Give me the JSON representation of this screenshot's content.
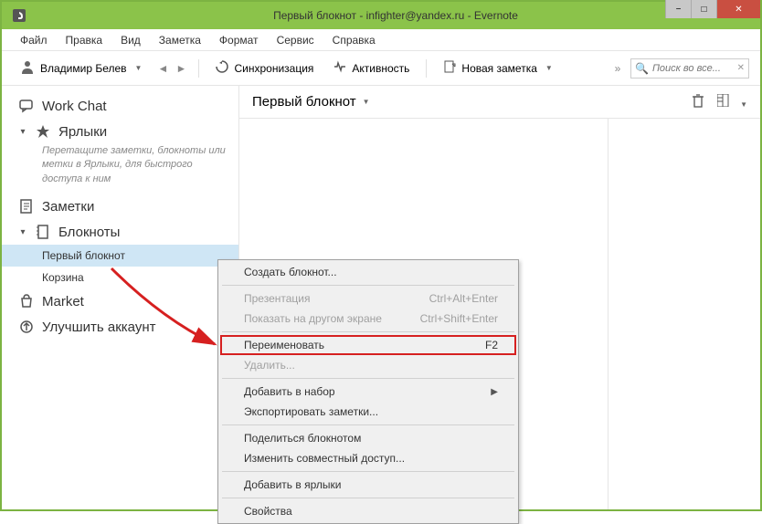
{
  "window": {
    "title": "Первый блокнот - infighter@yandex.ru - Evernote"
  },
  "menu": [
    "Файл",
    "Правка",
    "Вид",
    "Заметка",
    "Формат",
    "Сервис",
    "Справка"
  ],
  "toolbar": {
    "user": "Владимир Белев",
    "sync": "Синхронизация",
    "activity": "Активность",
    "newnote": "Новая заметка",
    "search_placeholder": "Поиск во все..."
  },
  "sidebar": {
    "workchat": "Work Chat",
    "shortcuts": "Ярлыки",
    "shortcuts_hint": "Перетащите заметки, блокноты или метки в Ярлыки, для быстрого доступа к ним",
    "notes": "Заметки",
    "notebooks": "Блокноты",
    "notebook_items": [
      "Первый блокнот",
      "Корзина"
    ],
    "market": "Market",
    "upgrade": "Улучшить аккаунт"
  },
  "content": {
    "title": "Первый блокнот"
  },
  "context_menu": [
    {
      "label": "Создать блокнот...",
      "shortcut": "",
      "enabled": true
    },
    {
      "sep": true
    },
    {
      "label": "Презентация",
      "shortcut": "Ctrl+Alt+Enter",
      "enabled": false
    },
    {
      "label": "Показать на другом экране",
      "shortcut": "Ctrl+Shift+Enter",
      "enabled": false
    },
    {
      "sep": true
    },
    {
      "label": "Переименовать",
      "shortcut": "F2",
      "enabled": true,
      "highlight": true
    },
    {
      "label": "Удалить...",
      "shortcut": "",
      "enabled": false
    },
    {
      "sep": true
    },
    {
      "label": "Добавить в набор",
      "shortcut": "",
      "enabled": true,
      "submenu": true
    },
    {
      "label": "Экспортировать заметки...",
      "shortcut": "",
      "enabled": true
    },
    {
      "sep": true
    },
    {
      "label": "Поделиться блокнотом",
      "shortcut": "",
      "enabled": true
    },
    {
      "label": "Изменить совместный доступ...",
      "shortcut": "",
      "enabled": true
    },
    {
      "sep": true
    },
    {
      "label": "Добавить в ярлыки",
      "shortcut": "",
      "enabled": true
    },
    {
      "sep": true
    },
    {
      "label": "Свойства",
      "shortcut": "",
      "enabled": true
    }
  ]
}
